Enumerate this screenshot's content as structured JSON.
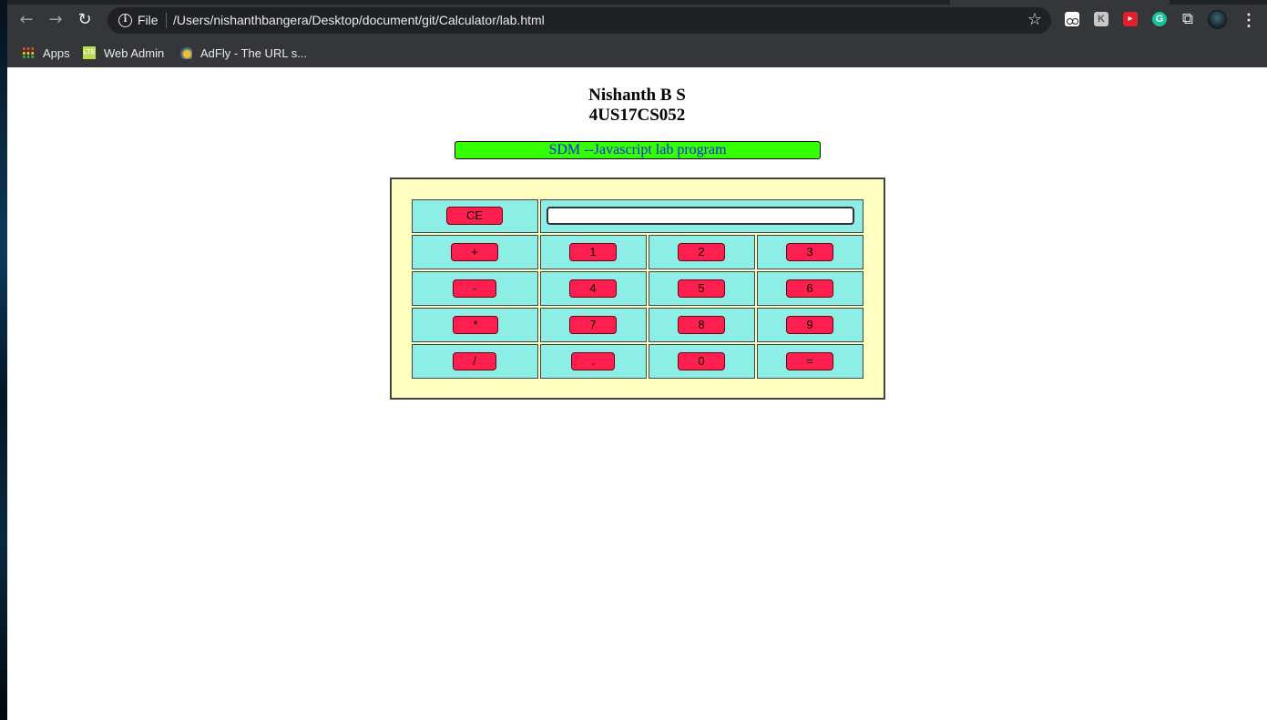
{
  "browser": {
    "scheme_label": "File",
    "url": "/Users/nishanthbangera/Desktop/document/git/Calculator/lab.html",
    "extension_labels": {
      "k": "K",
      "red": "▸",
      "grammarly": "G"
    },
    "bookmarks": [
      {
        "label": "Apps",
        "icon": "apps-grid-icon"
      },
      {
        "label": "Web Admin",
        "icon": "lte-icon"
      },
      {
        "label": "AdFly - The URL s...",
        "icon": "adfly-icon"
      }
    ]
  },
  "page": {
    "name": "Nishanth B S",
    "usn": "4US17CS052",
    "banner": "SDM --Javascript lab program",
    "banner_bg": "#33ff00",
    "banner_color": "#1a1aff"
  },
  "calculator": {
    "clear_label": "CE",
    "display_value": "",
    "rows": [
      [
        "+",
        "1",
        "2",
        "3"
      ],
      [
        "-",
        "4",
        "5",
        "6"
      ],
      [
        "*",
        "7",
        "8",
        "9"
      ],
      [
        "/",
        ".",
        "0",
        "="
      ]
    ],
    "colors": {
      "panel": "#ffffc2",
      "cell": "#8ceee4",
      "button": "#ff1f4f"
    }
  }
}
